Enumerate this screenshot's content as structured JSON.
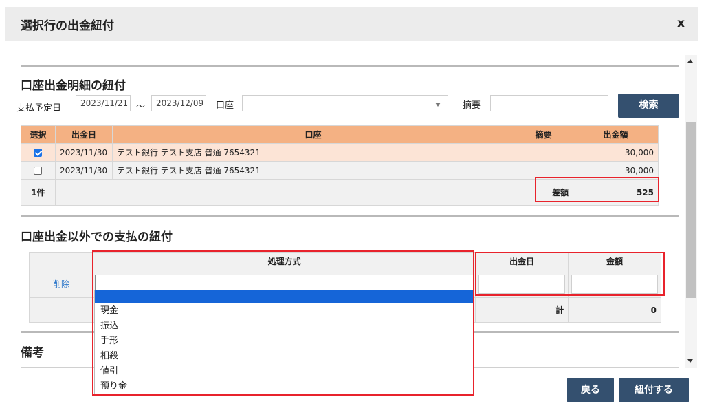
{
  "dialog": {
    "title": "選択行の出金紐付",
    "close_label": "x"
  },
  "section1": {
    "title": "口座出金明細の紐付",
    "filter": {
      "date_label": "支払予定日",
      "date_from": "2023/11/21",
      "date_sep": "～",
      "date_to": "2023/12/09",
      "account_label": "口座",
      "account_value": "",
      "memo_label": "摘要",
      "memo_value": "",
      "search_label": "検索"
    },
    "table": {
      "headers": [
        "選択",
        "出金日",
        "口座",
        "摘要",
        "出金額"
      ],
      "rows": [
        {
          "checked": true,
          "date": "2023/11/30",
          "account": "テスト銀行 テスト支店 普通 7654321",
          "memo": "",
          "amount": "30,000"
        },
        {
          "checked": false,
          "date": "2023/11/30",
          "account": "テスト銀行 テスト支店 普通 7654321",
          "memo": "",
          "amount": "30,000"
        }
      ],
      "count": "1件",
      "diff_label": "差額",
      "diff_value": "525"
    }
  },
  "section2": {
    "title": "口座出金以外での支払の紐付",
    "table": {
      "headers": [
        "処理方式",
        "出金日",
        "金額"
      ],
      "delete_label": "削除",
      "total_label": "計",
      "total_value": "0"
    },
    "dropdown_options": [
      "",
      "現金",
      "振込",
      "手形",
      "相殺",
      "値引",
      "預り金"
    ]
  },
  "section3": {
    "title": "備考"
  },
  "footer": {
    "back_label": "戻る",
    "submit_label": "紐付する"
  },
  "colors": {
    "header_orange": "#f4b183",
    "selected_row": "#fce4d6",
    "button": "#34506f",
    "highlight": "#e8232c",
    "option_hover": "#1565d8"
  }
}
